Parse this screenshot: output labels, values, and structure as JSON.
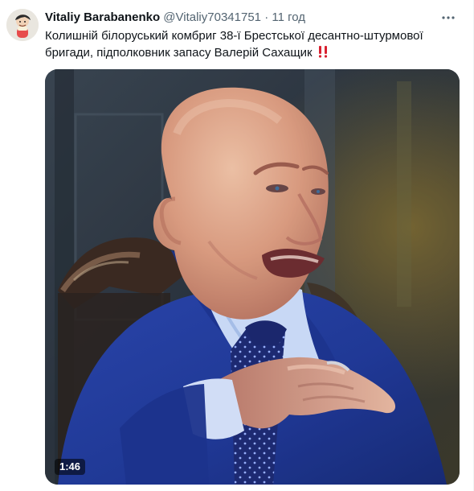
{
  "tweet": {
    "author_name": "Vitaliy Barabanenko",
    "author_handle": "@Vitaliy70341751",
    "separator": "·",
    "timestamp": "11 год",
    "text": "Колишній білоруський комбриг 38-ї Брестської десантно-штурмової бригади, підполковник запасу Валерій Сахащик",
    "emoji": "‼️"
  },
  "media": {
    "type": "video",
    "duration": "1:46"
  },
  "icons": {
    "more": "more-horizontal-icon",
    "emoji": "double-exclamation-icon"
  },
  "colors": {
    "text_primary": "#0f1419",
    "text_secondary": "#536471",
    "emoji_red": "#d8202f",
    "suit_blue": "#213b9a"
  }
}
